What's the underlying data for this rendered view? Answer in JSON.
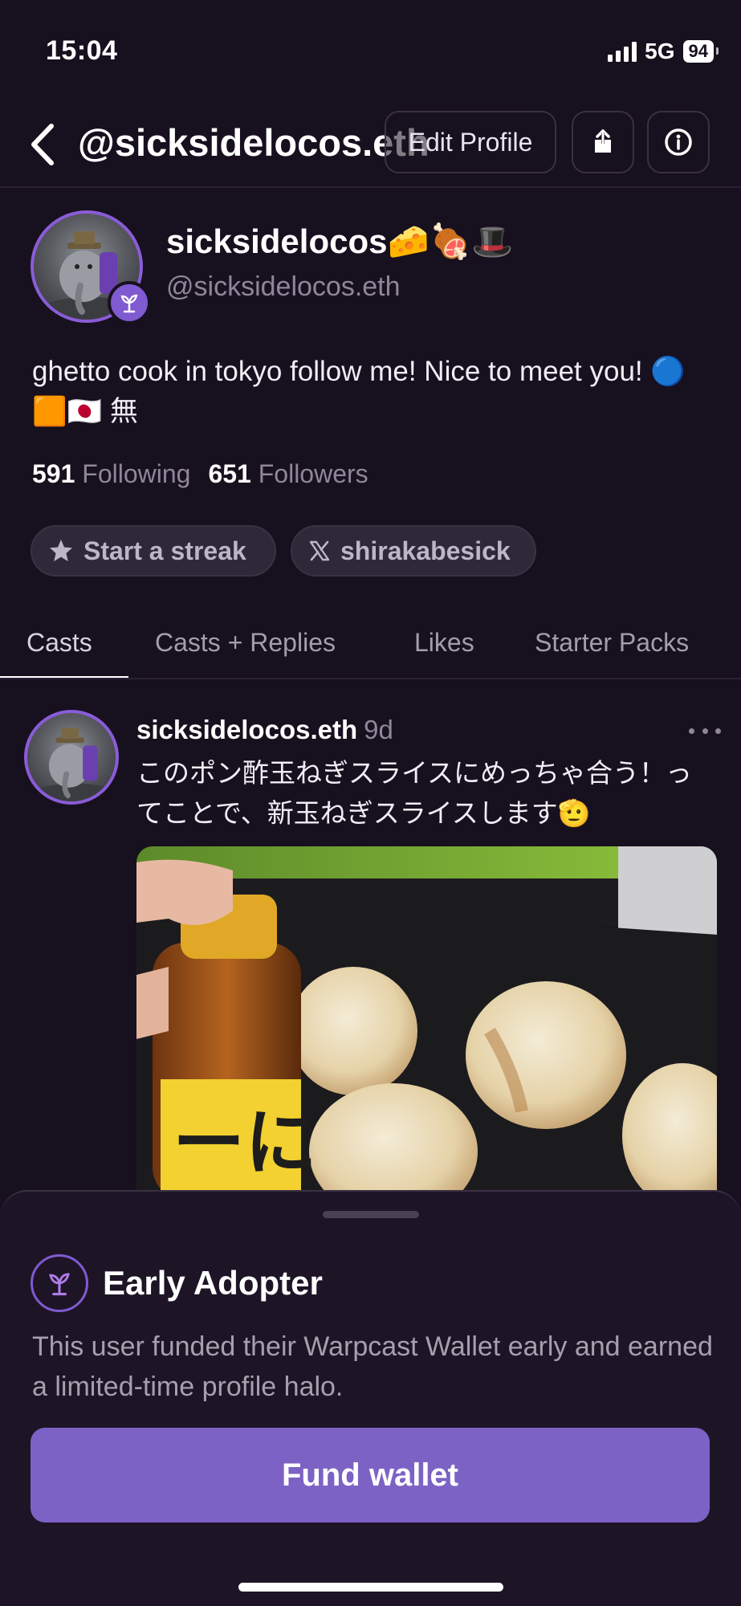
{
  "status_bar": {
    "time": "15:04",
    "network": "5G",
    "battery": "94"
  },
  "header": {
    "title": "@sicksidelocos.eth",
    "edit_profile_label": "Edit Profile"
  },
  "profile": {
    "display_name": "sicksidelocos🧀🍖🎩",
    "username": "@sicksidelocos.eth",
    "bio": "ghetto cook in tokyo follow me! Nice to meet you! 🔵🟧🇯🇵 無",
    "following_count": "591",
    "following_label": "Following",
    "followers_count": "651",
    "followers_label": "Followers",
    "streak_label": "Start a streak",
    "x_handle": "shirakabesick"
  },
  "tabs": [
    {
      "label": "Casts",
      "active": true
    },
    {
      "label": "Casts + Replies",
      "active": false
    },
    {
      "label": "Likes",
      "active": false
    },
    {
      "label": "Starter Packs",
      "active": false
    }
  ],
  "cast": {
    "author": "sicksidelocos.eth",
    "time": "9d",
    "text": "このポン酢玉ねぎスライスにめっちゃ合う！ってことで、新玉ねぎスライスします🫡"
  },
  "sheet": {
    "title": "Early Adopter",
    "description": "This user funded their Warpcast Wallet early and earned a limited-time profile halo.",
    "button_label": "Fund wallet"
  },
  "icons": {
    "back": "chevron-left-icon",
    "share": "share-icon",
    "info": "info-icon",
    "halo": "sprout-icon",
    "star": "star-icon",
    "x": "x-logo-icon",
    "more": "more-dots-icon"
  },
  "colors": {
    "background": "#17101f",
    "accent": "#7c62c4",
    "muted": "#8f8799"
  }
}
